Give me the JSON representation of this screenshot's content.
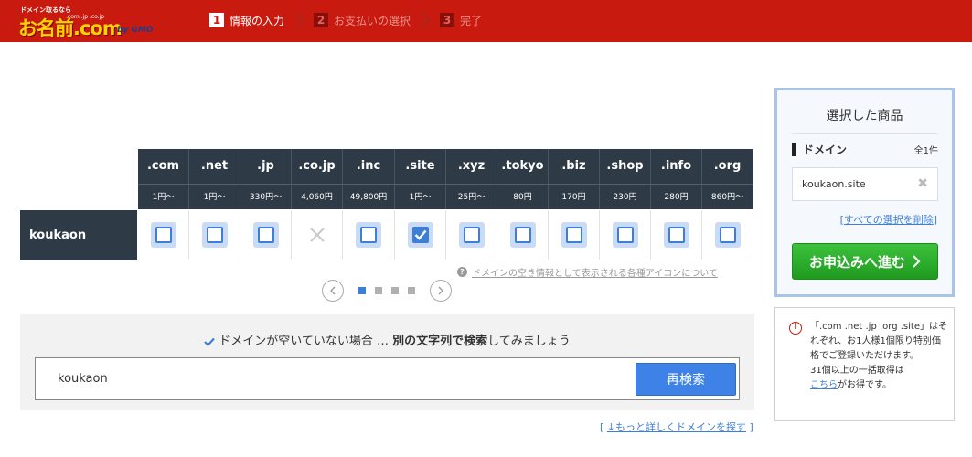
{
  "header": {
    "logo_tag": "ドメイン取るなら",
    "logo_main": "お名前.com",
    "logo_tlds": ".com .jp .co.jp",
    "logo_by": "by GMO",
    "steps": [
      {
        "num": "1",
        "label": "情報の入力"
      },
      {
        "num": "2",
        "label": "お支払いの選択"
      },
      {
        "num": "3",
        "label": "完了"
      }
    ]
  },
  "results": {
    "query": "koukaon",
    "tlds": [
      {
        "name": ".com",
        "price": "1円〜",
        "state": "available"
      },
      {
        "name": ".net",
        "price": "1円〜",
        "state": "available"
      },
      {
        "name": ".jp",
        "price": "330円〜",
        "state": "available"
      },
      {
        "name": ".co.jp",
        "price": "4,060円",
        "state": "unavailable"
      },
      {
        "name": ".inc",
        "price": "49,800円",
        "state": "available"
      },
      {
        "name": ".site",
        "price": "1円〜",
        "state": "selected"
      },
      {
        "name": ".xyz",
        "price": "25円〜",
        "state": "available"
      },
      {
        "name": ".tokyo",
        "price": "80円",
        "state": "available"
      },
      {
        "name": ".biz",
        "price": "170円",
        "state": "available"
      },
      {
        "name": ".shop",
        "price": "230円",
        "state": "available"
      },
      {
        "name": ".info",
        "price": "280円",
        "state": "available"
      },
      {
        "name": ".org",
        "price": "860円〜",
        "state": "available"
      }
    ],
    "help_text": "ドメインの空き情報として表示される各種アイコンについて",
    "help_icon": "?",
    "pager": {
      "dots": 4,
      "active": 1
    }
  },
  "search": {
    "hint_prefix": "ドメインが空いていない場合 … ",
    "hint_bold": "別の文字列で検索",
    "hint_suffix": "してみましょう",
    "input_value": "koukaon",
    "button": "再検索",
    "more_open": "[",
    "more_link": "↓もっと詳しくドメインを探す",
    "more_close": "]"
  },
  "cart": {
    "title": "選択した商品",
    "section": "ドメイン",
    "count": "全1件",
    "item": "koukaon.site",
    "remove_icon": "✖",
    "clear_open": "[",
    "clear_link": "すべての選択を削除",
    "clear_close": "]",
    "proceed": "お申込みへ進む"
  },
  "note": {
    "icon": "i",
    "text1": "「.com .net .jp .org .site」はそれぞれ、お1人様1個限り特別価格でご登録いただけます。",
    "text2": "31個以上の一括取得は",
    "link": "こちら",
    "text3": "がお得です。"
  },
  "colors": {
    "header_bg": "#c81a0e",
    "table_head_bg": "#2f3a47",
    "accent_blue": "#3e82e8",
    "proceed_green": "#22a322"
  }
}
